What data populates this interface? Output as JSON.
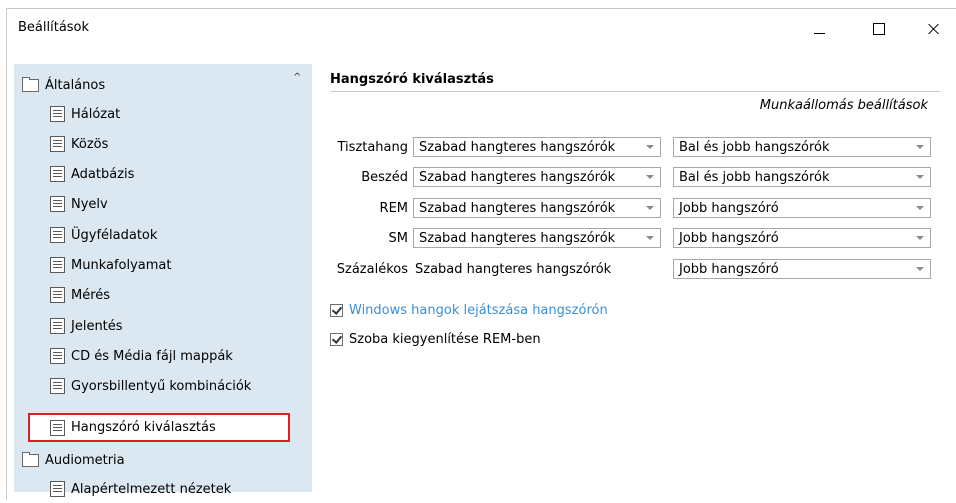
{
  "window": {
    "title": "Beállítások"
  },
  "sidebar": {
    "items": [
      {
        "label": "Általános",
        "icon": "folder-icon"
      },
      {
        "label": "Hálózat",
        "icon": "document-icon"
      },
      {
        "label": "Közös",
        "icon": "document-icon"
      },
      {
        "label": "Adatbázis",
        "icon": "document-icon"
      },
      {
        "label": "Nyelv",
        "icon": "document-icon"
      },
      {
        "label": "Ügyféladatok",
        "icon": "document-icon"
      },
      {
        "label": "Munkafolyamat",
        "icon": "document-icon"
      },
      {
        "label": "Mérés",
        "icon": "document-icon"
      },
      {
        "label": "Jelentés",
        "icon": "document-icon"
      },
      {
        "label": "CD és Média fájl mappák",
        "icon": "document-icon"
      },
      {
        "label": "Gyorsbillentyű kombinációk",
        "icon": "document-icon"
      },
      {
        "label": "Hangszóró kiválasztás",
        "icon": "document-icon",
        "selected": true
      },
      {
        "label": "Audiometria",
        "icon": "folder-icon"
      },
      {
        "label": "Alapértelmezett nézetek",
        "icon": "document-icon"
      }
    ]
  },
  "main": {
    "title": "Hangszóró kiválasztás",
    "subtitle": "Munkaállomás beállítások",
    "rows": [
      {
        "label": "Tisztahang",
        "mode": "Szabad hangteres hangszórók",
        "side": "Bal és jobb hangszórók"
      },
      {
        "label": "Beszéd",
        "mode": "Szabad hangteres hangszórók",
        "side": "Bal és jobb hangszórók"
      },
      {
        "label": "REM",
        "mode": "Szabad hangteres hangszórók",
        "side": "Jobb hangszóró"
      },
      {
        "label": "SM",
        "mode": "Szabad hangteres hangszórók",
        "side": "Jobb hangszóró"
      },
      {
        "label": "Százalékos",
        "mode": "Szabad hangteres hangszórók",
        "side": "Jobb hangszóró"
      }
    ],
    "checkboxes": [
      {
        "label": "Windows hangok lejátszása hangszórón",
        "checked": true
      },
      {
        "label": "Szoba kiegyenlítése REM-ben",
        "checked": true
      }
    ]
  },
  "colors": {
    "sidebar_bg": "#dce8f1",
    "selection_border": "#e02020",
    "link_blue": "#3a8fd0"
  }
}
